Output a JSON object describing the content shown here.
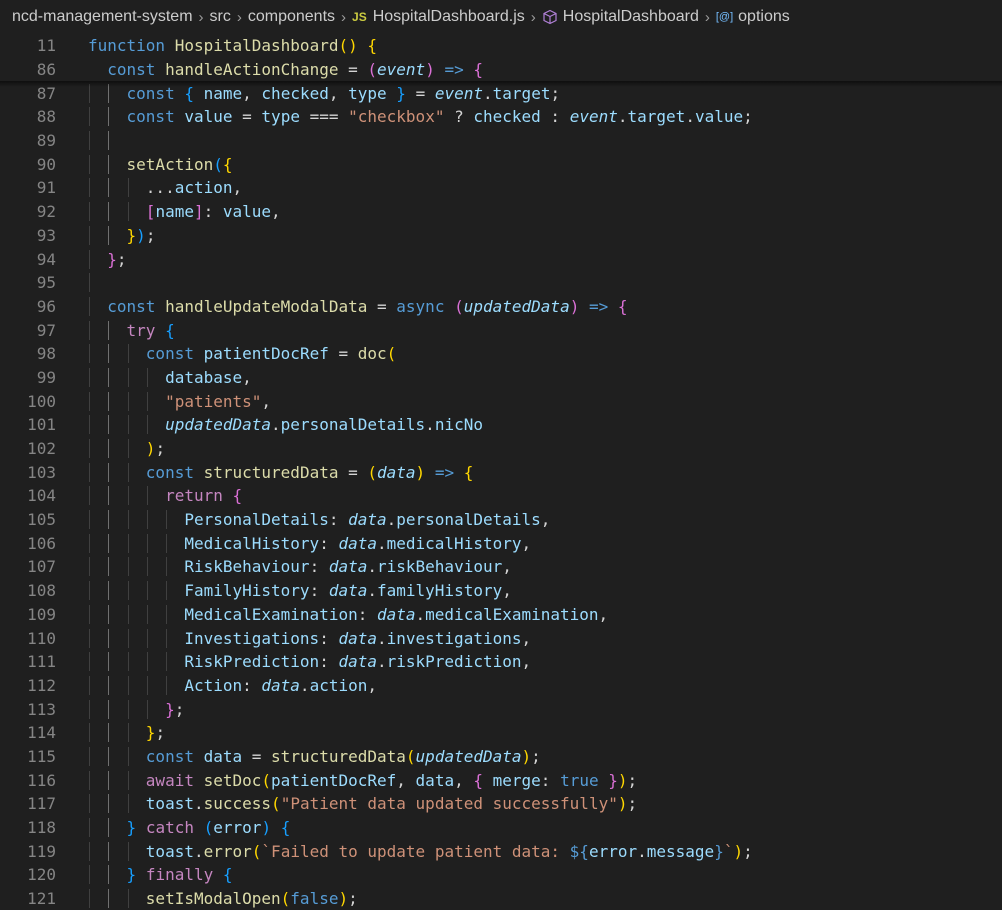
{
  "breadcrumb": {
    "items": [
      {
        "label": "ncd-management-system",
        "icon": null
      },
      {
        "label": "src",
        "icon": null
      },
      {
        "label": "components",
        "icon": null
      },
      {
        "label": "HospitalDashboard.js",
        "icon": "js-file-icon",
        "icon_text": "JS"
      },
      {
        "label": "HospitalDashboard",
        "icon": "symbol-class-icon"
      },
      {
        "label": "options",
        "icon": "symbol-variable-icon"
      }
    ]
  },
  "editor": {
    "sticky_lines": [
      {
        "number": "11",
        "indent": 0,
        "tokens": [
          [
            "k",
            "function"
          ],
          [
            "pl",
            " "
          ],
          [
            "f",
            "HospitalDashboard"
          ],
          [
            "b1",
            "()"
          ],
          [
            "pl",
            " "
          ],
          [
            "b1",
            "{"
          ]
        ]
      },
      {
        "number": "86",
        "indent": 1,
        "tokens": [
          [
            "k",
            "const"
          ],
          [
            "pl",
            " "
          ],
          [
            "f",
            "handleActionChange"
          ],
          [
            "pl",
            " = "
          ],
          [
            "b2",
            "("
          ],
          [
            "p",
            "event"
          ],
          [
            "b2",
            ")"
          ],
          [
            "pl",
            " "
          ],
          [
            "k",
            "=>"
          ],
          [
            "pl",
            " "
          ],
          [
            "b2",
            "{"
          ]
        ]
      }
    ],
    "lines": [
      {
        "number": "87",
        "indent": 2,
        "tokens": [
          [
            "k",
            "const"
          ],
          [
            "pl",
            " "
          ],
          [
            "b3",
            "{"
          ],
          [
            "pl",
            " "
          ],
          [
            "v",
            "name"
          ],
          [
            "pl",
            ", "
          ],
          [
            "v",
            "checked"
          ],
          [
            "pl",
            ", "
          ],
          [
            "v",
            "type"
          ],
          [
            "pl",
            " "
          ],
          [
            "b3",
            "}"
          ],
          [
            "pl",
            " = "
          ],
          [
            "p",
            "event"
          ],
          [
            "pl",
            "."
          ],
          [
            "v",
            "target"
          ],
          [
            "pl",
            ";"
          ]
        ]
      },
      {
        "number": "88",
        "indent": 2,
        "tokens": [
          [
            "k",
            "const"
          ],
          [
            "pl",
            " "
          ],
          [
            "v",
            "value"
          ],
          [
            "pl",
            " = "
          ],
          [
            "v",
            "type"
          ],
          [
            "pl",
            " === "
          ],
          [
            "s",
            "\"checkbox\""
          ],
          [
            "pl",
            " ? "
          ],
          [
            "v",
            "checked"
          ],
          [
            "pl",
            " : "
          ],
          [
            "p",
            "event"
          ],
          [
            "pl",
            "."
          ],
          [
            "v",
            "target"
          ],
          [
            "pl",
            "."
          ],
          [
            "v",
            "value"
          ],
          [
            "pl",
            ";"
          ]
        ]
      },
      {
        "number": "89",
        "indent": 2,
        "tokens": []
      },
      {
        "number": "90",
        "indent": 2,
        "tokens": [
          [
            "f",
            "setAction"
          ],
          [
            "b3",
            "("
          ],
          [
            "b1",
            "{"
          ]
        ]
      },
      {
        "number": "91",
        "indent": 3,
        "tokens": [
          [
            "pl",
            "..."
          ],
          [
            "v",
            "action"
          ],
          [
            "pl",
            ","
          ]
        ]
      },
      {
        "number": "92",
        "indent": 3,
        "tokens": [
          [
            "b2",
            "["
          ],
          [
            "v",
            "name"
          ],
          [
            "b2",
            "]"
          ],
          [
            "pl",
            ": "
          ],
          [
            "v",
            "value"
          ],
          [
            "pl",
            ","
          ]
        ]
      },
      {
        "number": "93",
        "indent": 2,
        "tokens": [
          [
            "b1",
            "}"
          ],
          [
            "b3",
            ")"
          ],
          [
            "pl",
            ";"
          ]
        ]
      },
      {
        "number": "94",
        "indent": 1,
        "tokens": [
          [
            "b2",
            "}"
          ],
          [
            "pl",
            ";"
          ]
        ]
      },
      {
        "number": "95",
        "indent": 1,
        "tokens": []
      },
      {
        "number": "96",
        "indent": 1,
        "tokens": [
          [
            "k",
            "const"
          ],
          [
            "pl",
            " "
          ],
          [
            "f",
            "handleUpdateModalData"
          ],
          [
            "pl",
            " = "
          ],
          [
            "k",
            "async"
          ],
          [
            "pl",
            " "
          ],
          [
            "b2",
            "("
          ],
          [
            "p",
            "updatedData"
          ],
          [
            "b2",
            ")"
          ],
          [
            "pl",
            " "
          ],
          [
            "k",
            "=>"
          ],
          [
            "pl",
            " "
          ],
          [
            "b2",
            "{"
          ]
        ]
      },
      {
        "number": "97",
        "indent": 2,
        "tokens": [
          [
            "c",
            "try"
          ],
          [
            "pl",
            " "
          ],
          [
            "b3",
            "{"
          ]
        ]
      },
      {
        "number": "98",
        "indent": 3,
        "tokens": [
          [
            "k",
            "const"
          ],
          [
            "pl",
            " "
          ],
          [
            "v",
            "patientDocRef"
          ],
          [
            "pl",
            " = "
          ],
          [
            "f",
            "doc"
          ],
          [
            "b1",
            "("
          ]
        ]
      },
      {
        "number": "99",
        "indent": 4,
        "tokens": [
          [
            "v",
            "database"
          ],
          [
            "pl",
            ","
          ]
        ]
      },
      {
        "number": "100",
        "indent": 4,
        "tokens": [
          [
            "s",
            "\"patients\""
          ],
          [
            "pl",
            ","
          ]
        ]
      },
      {
        "number": "101",
        "indent": 4,
        "tokens": [
          [
            "p",
            "updatedData"
          ],
          [
            "pl",
            "."
          ],
          [
            "v",
            "personalDetails"
          ],
          [
            "pl",
            "."
          ],
          [
            "v",
            "nicNo"
          ]
        ]
      },
      {
        "number": "102",
        "indent": 3,
        "tokens": [
          [
            "b1",
            ")"
          ],
          [
            "pl",
            ";"
          ]
        ]
      },
      {
        "number": "103",
        "indent": 3,
        "tokens": [
          [
            "k",
            "const"
          ],
          [
            "pl",
            " "
          ],
          [
            "f",
            "structuredData"
          ],
          [
            "pl",
            " = "
          ],
          [
            "b1",
            "("
          ],
          [
            "p",
            "data"
          ],
          [
            "b1",
            ")"
          ],
          [
            "pl",
            " "
          ],
          [
            "k",
            "=>"
          ],
          [
            "pl",
            " "
          ],
          [
            "b1",
            "{"
          ]
        ]
      },
      {
        "number": "104",
        "indent": 4,
        "tokens": [
          [
            "c",
            "return"
          ],
          [
            "pl",
            " "
          ],
          [
            "b2",
            "{"
          ]
        ]
      },
      {
        "number": "105",
        "indent": 5,
        "tokens": [
          [
            "v",
            "PersonalDetails"
          ],
          [
            "pl",
            ": "
          ],
          [
            "p",
            "data"
          ],
          [
            "pl",
            "."
          ],
          [
            "v",
            "personalDetails"
          ],
          [
            "pl",
            ","
          ]
        ]
      },
      {
        "number": "106",
        "indent": 5,
        "tokens": [
          [
            "v",
            "MedicalHistory"
          ],
          [
            "pl",
            ": "
          ],
          [
            "p",
            "data"
          ],
          [
            "pl",
            "."
          ],
          [
            "v",
            "medicalHistory"
          ],
          [
            "pl",
            ","
          ]
        ]
      },
      {
        "number": "107",
        "indent": 5,
        "tokens": [
          [
            "v",
            "RiskBehaviour"
          ],
          [
            "pl",
            ": "
          ],
          [
            "p",
            "data"
          ],
          [
            "pl",
            "."
          ],
          [
            "v",
            "riskBehaviour"
          ],
          [
            "pl",
            ","
          ]
        ]
      },
      {
        "number": "108",
        "indent": 5,
        "tokens": [
          [
            "v",
            "FamilyHistory"
          ],
          [
            "pl",
            ": "
          ],
          [
            "p",
            "data"
          ],
          [
            "pl",
            "."
          ],
          [
            "v",
            "familyHistory"
          ],
          [
            "pl",
            ","
          ]
        ]
      },
      {
        "number": "109",
        "indent": 5,
        "tokens": [
          [
            "v",
            "MedicalExamination"
          ],
          [
            "pl",
            ": "
          ],
          [
            "p",
            "data"
          ],
          [
            "pl",
            "."
          ],
          [
            "v",
            "medicalExamination"
          ],
          [
            "pl",
            ","
          ]
        ]
      },
      {
        "number": "110",
        "indent": 5,
        "tokens": [
          [
            "v",
            "Investigations"
          ],
          [
            "pl",
            ": "
          ],
          [
            "p",
            "data"
          ],
          [
            "pl",
            "."
          ],
          [
            "v",
            "investigations"
          ],
          [
            "pl",
            ","
          ]
        ]
      },
      {
        "number": "111",
        "indent": 5,
        "tokens": [
          [
            "v",
            "RiskPrediction"
          ],
          [
            "pl",
            ": "
          ],
          [
            "p",
            "data"
          ],
          [
            "pl",
            "."
          ],
          [
            "v",
            "riskPrediction"
          ],
          [
            "pl",
            ","
          ]
        ]
      },
      {
        "number": "112",
        "indent": 5,
        "tokens": [
          [
            "v",
            "Action"
          ],
          [
            "pl",
            ": "
          ],
          [
            "p",
            "data"
          ],
          [
            "pl",
            "."
          ],
          [
            "v",
            "action"
          ],
          [
            "pl",
            ","
          ]
        ]
      },
      {
        "number": "113",
        "indent": 4,
        "tokens": [
          [
            "b2",
            "}"
          ],
          [
            "pl",
            ";"
          ]
        ]
      },
      {
        "number": "114",
        "indent": 3,
        "tokens": [
          [
            "b1",
            "}"
          ],
          [
            "pl",
            ";"
          ]
        ]
      },
      {
        "number": "115",
        "indent": 3,
        "tokens": [
          [
            "k",
            "const"
          ],
          [
            "pl",
            " "
          ],
          [
            "v",
            "data"
          ],
          [
            "pl",
            " = "
          ],
          [
            "f",
            "structuredData"
          ],
          [
            "b1",
            "("
          ],
          [
            "p",
            "updatedData"
          ],
          [
            "b1",
            ")"
          ],
          [
            "pl",
            ";"
          ]
        ]
      },
      {
        "number": "116",
        "indent": 3,
        "tokens": [
          [
            "c",
            "await"
          ],
          [
            "pl",
            " "
          ],
          [
            "f",
            "setDoc"
          ],
          [
            "b1",
            "("
          ],
          [
            "v",
            "patientDocRef"
          ],
          [
            "pl",
            ", "
          ],
          [
            "v",
            "data"
          ],
          [
            "pl",
            ", "
          ],
          [
            "b2",
            "{"
          ],
          [
            "pl",
            " "
          ],
          [
            "v",
            "merge"
          ],
          [
            "pl",
            ": "
          ],
          [
            "k",
            "true"
          ],
          [
            "pl",
            " "
          ],
          [
            "b2",
            "}"
          ],
          [
            "b1",
            ")"
          ],
          [
            "pl",
            ";"
          ]
        ]
      },
      {
        "number": "117",
        "indent": 3,
        "tokens": [
          [
            "v",
            "toast"
          ],
          [
            "pl",
            "."
          ],
          [
            "f",
            "success"
          ],
          [
            "b1",
            "("
          ],
          [
            "s",
            "\"Patient data updated successfully\""
          ],
          [
            "b1",
            ")"
          ],
          [
            "pl",
            ";"
          ]
        ]
      },
      {
        "number": "118",
        "indent": 2,
        "tokens": [
          [
            "b3",
            "}"
          ],
          [
            "pl",
            " "
          ],
          [
            "c",
            "catch"
          ],
          [
            "pl",
            " "
          ],
          [
            "b3",
            "("
          ],
          [
            "v",
            "error"
          ],
          [
            "b3",
            ")"
          ],
          [
            "pl",
            " "
          ],
          [
            "b3",
            "{"
          ]
        ]
      },
      {
        "number": "119",
        "indent": 3,
        "tokens": [
          [
            "v",
            "toast"
          ],
          [
            "pl",
            "."
          ],
          [
            "f",
            "error"
          ],
          [
            "b1",
            "("
          ],
          [
            "s",
            "`Failed to update patient data: "
          ],
          [
            "k",
            "${"
          ],
          [
            "v",
            "error"
          ],
          [
            "pl",
            "."
          ],
          [
            "v",
            "message"
          ],
          [
            "k",
            "}"
          ],
          [
            "s",
            "`"
          ],
          [
            "b1",
            ")"
          ],
          [
            "pl",
            ";"
          ]
        ]
      },
      {
        "number": "120",
        "indent": 2,
        "tokens": [
          [
            "b3",
            "}"
          ],
          [
            "pl",
            " "
          ],
          [
            "c",
            "finally"
          ],
          [
            "pl",
            " "
          ],
          [
            "b3",
            "{"
          ]
        ]
      },
      {
        "number": "121",
        "indent": 3,
        "tokens": [
          [
            "f",
            "setIsModalOpen"
          ],
          [
            "b1",
            "("
          ],
          [
            "k",
            "false"
          ],
          [
            "b1",
            ")"
          ],
          [
            "pl",
            ";"
          ]
        ]
      }
    ]
  }
}
